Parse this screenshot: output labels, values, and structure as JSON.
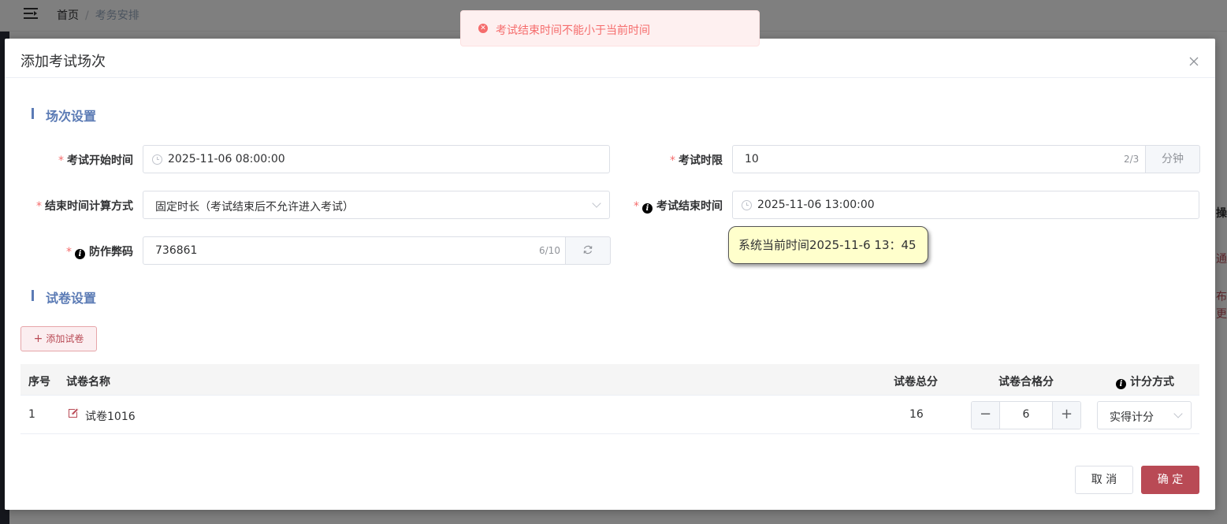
{
  "background": {
    "breadcrumb": {
      "home": "首页",
      "separator": "/",
      "current": "考务安排"
    },
    "right_col": {
      "r1": "操作",
      "r2": "通",
      "r3": "布考",
      "r4": "更多"
    }
  },
  "message": {
    "icon": "error-circle-icon",
    "text": "考试结束时间不能小于当前时间"
  },
  "dialog": {
    "title": "添加考试场次",
    "section_session": "场次设置",
    "section_paper": "试卷设置",
    "fields": {
      "start_time": {
        "label": "考试开始时间",
        "value": "2025-11-06 08:00:00"
      },
      "time_limit": {
        "label": "考试时限",
        "value": "10",
        "count": "2/3",
        "unit": "分钟"
      },
      "end_mode": {
        "label": "结束时间计算方式",
        "value": "固定时长（考试结束后不允许进入考试）"
      },
      "end_time": {
        "label": "考试结束时间",
        "value": "2025-11-06 13:00:00"
      },
      "anti_cheat": {
        "label": "防作弊码",
        "value": "736861",
        "count": "6/10"
      }
    },
    "tooltip": "系统当前时间2025-11-6 13：45",
    "add_paper_label": "添加试卷",
    "table": {
      "headers": {
        "index": "序号",
        "name": "试卷名称",
        "total": "试卷总分",
        "pass": "试卷合格分",
        "scoring": "计分方式"
      },
      "rows": [
        {
          "index": "1",
          "name": "试卷1016",
          "total": "16",
          "pass": "6",
          "scoring": "实得计分"
        }
      ]
    },
    "cancel_label": "取 消",
    "ok_label": "确 定"
  }
}
